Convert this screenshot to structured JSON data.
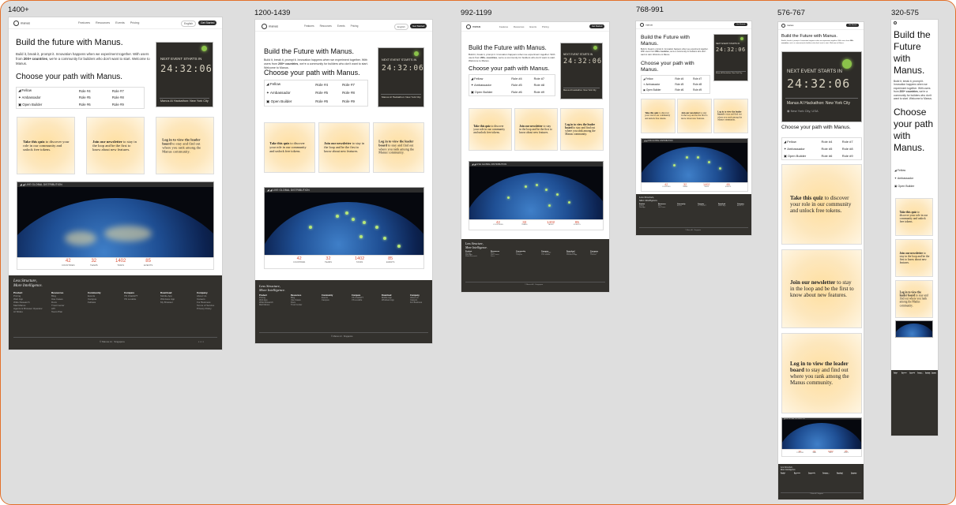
{
  "breakpoints": [
    "1400+",
    "1200-1439",
    "992-1199",
    "768-991",
    "576-767",
    "320-575"
  ],
  "nav": {
    "brand": "manus",
    "links": [
      "Features",
      "Resources",
      "Events",
      "Pricing"
    ],
    "lang": "English",
    "cta": "Get Started"
  },
  "hero": {
    "title_a": "Build the future with Manus.",
    "title_b": "Build the Future with Manus.",
    "body_pre": "Build it, break it, prompt it. Innovation happens when we experiment together. With users from ",
    "body_bold": "200+ countries",
    "body_post": ", we're a community for builders who don't want to start. Welcome to Manus."
  },
  "path": {
    "title": "Choose your path with Manus.",
    "roles": [
      [
        "Fellow",
        "Role #4",
        "Role #7"
      ],
      [
        "Ambassador",
        "Role #5",
        "Role #8"
      ],
      [
        "Open Builder",
        "Role #6",
        "Role #9"
      ]
    ]
  },
  "event": {
    "label": "NEXT EVENT STARTS IN",
    "countdown": "24:32:06",
    "name": "Manus AI Hackathon: New York City",
    "location": "New York City, USA"
  },
  "cards": [
    {
      "bold": "Take this quiz",
      "rest": " to discover your role in our community and unlock free tokens."
    },
    {
      "bold": "Join our newsletter",
      "rest": " to stay in the loop and be the first to know about new features."
    },
    {
      "bold": "Log in to view the leader board",
      "rest": " to stay and find out where you rank among the Manus community."
    }
  ],
  "distribution": {
    "label": "LIVE GLOBAL DISTRIBUTION",
    "stats": [
      {
        "value": "42",
        "label": "COUNTRIES"
      },
      {
        "value": "32",
        "label": "TEAMS"
      },
      {
        "value": "1402",
        "label": "TASKS"
      },
      {
        "value": "85",
        "label": "EVENTS"
      }
    ]
  },
  "footer": {
    "tagline_1": "Less Structure,",
    "tagline_2": "More Intelligence.",
    "columns": [
      {
        "head": "Product",
        "items": [
          "Pricing",
          "Web App",
          "Wide Research",
          "Mail Manus",
          "Agents & Browser Operator",
          "AI Slides",
          "Browser Integration"
        ]
      },
      {
        "head": "Resources",
        "items": [
          "Blog",
          "Use Cases",
          "Docs",
          "Trust Center",
          "API",
          "Team Plan",
          "Playbook",
          "Brand Assets"
        ]
      },
      {
        "head": "Community",
        "items": [
          "Events",
          "Campus",
          "Fellows"
        ]
      },
      {
        "head": "Compare",
        "items": [
          "VS ChatGPT",
          "VS Lovable"
        ]
      },
      {
        "head": "Download",
        "items": [
          "Mobile App",
          "Windows App",
          "My Browser"
        ]
      },
      {
        "head": "Company",
        "items": [
          "About Us",
          "Careers",
          "For Business",
          "Terms of Service",
          "Privacy Policy"
        ]
      }
    ],
    "copyright": "© Manus AI · Singapore",
    "socials": [
      "in",
      "x",
      "ig",
      "yt",
      "tt"
    ]
  }
}
